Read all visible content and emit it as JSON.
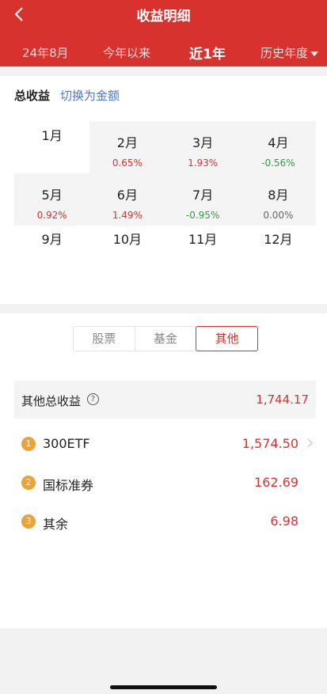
{
  "header": {
    "back_icon": "chevron-left-icon",
    "title": "收益明细",
    "tabs": [
      "24年8月",
      "今年以来",
      "近1年",
      "历史年度"
    ],
    "active_tab": "近1年"
  },
  "summary": {
    "title": "总收益",
    "switch_label": "切换为金额"
  },
  "months": [
    {
      "label": "1月",
      "pct": ""
    },
    {
      "label": "2月",
      "pct": "0.65%",
      "trend": "up"
    },
    {
      "label": "3月",
      "pct": "1.93%",
      "trend": "up"
    },
    {
      "label": "4月",
      "pct": "-0.56%",
      "trend": "down"
    },
    {
      "label": "5月",
      "pct": "0.92%",
      "trend": "up"
    },
    {
      "label": "6月",
      "pct": "1.49%",
      "trend": "up"
    },
    {
      "label": "7月",
      "pct": "-0.95%",
      "trend": "down"
    },
    {
      "label": "8月",
      "pct": "0.00%",
      "trend": "zero"
    },
    {
      "label": "9月",
      "pct": ""
    },
    {
      "label": "10月",
      "pct": ""
    },
    {
      "label": "11月",
      "pct": ""
    },
    {
      "label": "12月",
      "pct": ""
    }
  ],
  "segment": {
    "items": [
      "股票",
      "基金",
      "其他"
    ],
    "active": "其他"
  },
  "other": {
    "total_label": "其他总收益",
    "help_icon": "question-circle-icon",
    "total_value": "1,744.17",
    "items": [
      {
        "rank": "1",
        "name": "300ETF",
        "value": "1,574.50",
        "has_chevron": true
      },
      {
        "rank": "2",
        "name": "国标准券",
        "value": "162.69"
      },
      {
        "rank": "3",
        "name": "其余",
        "value": "6.98"
      }
    ]
  },
  "colors": {
    "brand_red": "#d8322f",
    "up": "#d8322f",
    "down": "#2ea043",
    "link_blue": "#4a7bd0",
    "rank_badge": "#e8a33b"
  }
}
